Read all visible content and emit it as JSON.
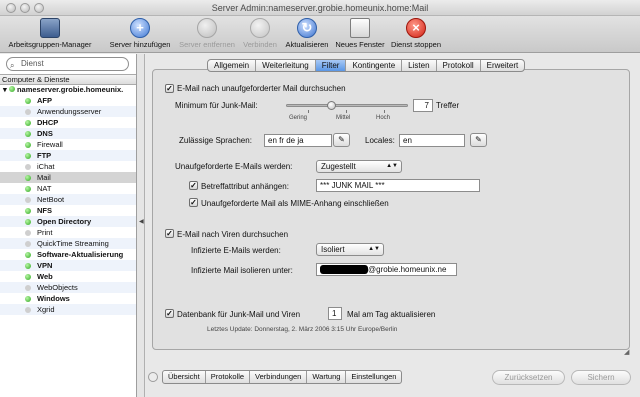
{
  "window": {
    "title": "Server Admin:nameserver.grobie.homeunix.home:Mail"
  },
  "toolbar": {
    "group_manager": "Arbeitsgruppen-Manager",
    "add_server": "Server hinzufügen",
    "remove_server": "Server entfernen",
    "connect": "Verbinden",
    "refresh": "Aktualisieren",
    "new_window": "Neues Fenster",
    "stop_service": "Dienst stoppen"
  },
  "sidebar": {
    "search_placeholder": "Dienst",
    "header": "Computer & Dienste",
    "server": "nameserver.grobie.homeunix.",
    "items": [
      {
        "label": "AFP",
        "bold": true,
        "status": "on"
      },
      {
        "label": "Anwendungsserver",
        "bold": false,
        "status": "off"
      },
      {
        "label": "DHCP",
        "bold": true,
        "status": "on"
      },
      {
        "label": "DNS",
        "bold": true,
        "status": "on"
      },
      {
        "label": "Firewall",
        "bold": false,
        "status": "on"
      },
      {
        "label": "FTP",
        "bold": true,
        "status": "on"
      },
      {
        "label": "iChat",
        "bold": false,
        "status": "off"
      },
      {
        "label": "Mail",
        "bold": false,
        "status": "on"
      },
      {
        "label": "NAT",
        "bold": false,
        "status": "on"
      },
      {
        "label": "NetBoot",
        "bold": false,
        "status": "off"
      },
      {
        "label": "NFS",
        "bold": true,
        "status": "on"
      },
      {
        "label": "Open Directory",
        "bold": true,
        "status": "on"
      },
      {
        "label": "Print",
        "bold": false,
        "status": "off"
      },
      {
        "label": "QuickTime Streaming",
        "bold": false,
        "status": "off"
      },
      {
        "label": "Software-Aktualisierung",
        "bold": true,
        "status": "on"
      },
      {
        "label": "VPN",
        "bold": true,
        "status": "on"
      },
      {
        "label": "Web",
        "bold": true,
        "status": "on"
      },
      {
        "label": "WebObjects",
        "bold": false,
        "status": "off"
      },
      {
        "label": "Windows",
        "bold": true,
        "status": "on"
      },
      {
        "label": "Xgrid",
        "bold": false,
        "status": "off"
      }
    ]
  },
  "tabs": [
    "Allgemein",
    "Weiterleitung",
    "Filter",
    "Kontingente",
    "Listen",
    "Protokoll",
    "Erweitert"
  ],
  "filter": {
    "junk_check": "E-Mail nach unaufgeforderter Mail durchsuchen",
    "junk_min_label": "Minimum für Junk-Mail:",
    "junk_min_value": "7",
    "junk_min_suffix": "Treffer",
    "slider_low": "Gering",
    "slider_mid": "Mittel",
    "slider_high": "Hoch",
    "languages_label": "Zulässige Sprachen:",
    "languages_value": "en fr de ja",
    "locales_label": "Locales:",
    "locales_value": "en",
    "unsolicited_label": "Unaufgeforderte E-Mails werden:",
    "unsolicited_value": "Zugestellt",
    "subject_tag_check": "Betreffattribut anhängen:",
    "subject_tag_value": "*** JUNK MAIL ***",
    "mime_check": "Unaufgeforderte Mail als MIME-Anhang einschließen",
    "virus_check": "E-Mail nach Viren durchsuchen",
    "infected_label": "Infizierte E-Mails werden:",
    "infected_value": "Isoliert",
    "quarantine_label": "Infizierte Mail isolieren unter:",
    "quarantine_domain": "@grobie.homeunix.ne",
    "update_check_prefix": "Datenbank für Junk-Mail und Viren",
    "update_value": "1",
    "update_check_suffix": "Mal am Tag aktualisieren",
    "last_update": "Letztes Update: Donnerstag, 2. März 2006 3:15 Uhr Europe/Berlin"
  },
  "bottom": {
    "tabs": [
      "Übersicht",
      "Protokolle",
      "Verbindungen",
      "Wartung",
      "Einstellungen"
    ],
    "revert": "Zurücksetzen",
    "save": "Sichern"
  }
}
